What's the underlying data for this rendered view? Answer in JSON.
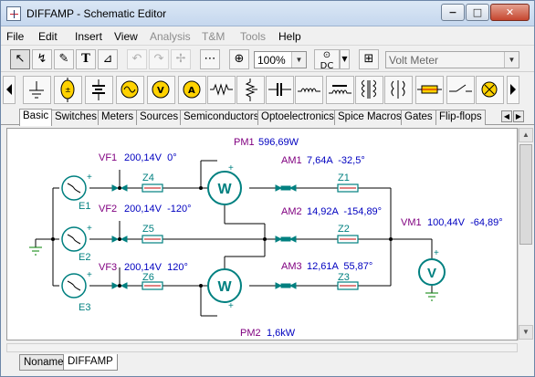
{
  "window": {
    "title": "DIFFAMP - Schematic Editor",
    "min_glyph": "−",
    "max_glyph": "□",
    "close_glyph": "✕"
  },
  "menu": [
    "File",
    "Edit",
    "Insert",
    "View",
    "Analysis",
    "T&M",
    "Tools",
    "Help"
  ],
  "menu_disabled": [
    "Analysis",
    "T&M",
    "Tools"
  ],
  "toolbar": {
    "zoom": "100%",
    "component": "Volt Meter"
  },
  "component_tabs": [
    "Basic",
    "Switches",
    "Meters",
    "Sources",
    "Semiconductors",
    "Optoelectronics",
    "Spice Macros",
    "Gates",
    "Flip-flops"
  ],
  "sheet_tabs": [
    "Noname",
    "DIFFAMP"
  ],
  "schematic": {
    "meters": [
      {
        "name": "PM1",
        "value": "596,69W"
      },
      {
        "name": "PM2",
        "value": "1,6kW"
      },
      {
        "name": "AM1",
        "value": "7,64A  -32,5°"
      },
      {
        "name": "AM2",
        "value": "14,92A  -154,89°"
      },
      {
        "name": "AM3",
        "value": "12,61A  55,87°"
      },
      {
        "name": "VM1",
        "value": "100,44V  -64,89°"
      }
    ],
    "voltmeters": [
      {
        "name": "VF1",
        "value": "200,14V  0°"
      },
      {
        "name": "VF2",
        "value": "200,14V  -120°"
      },
      {
        "name": "VF3",
        "value": "200,14V  120°"
      }
    ],
    "sources": [
      "E1",
      "E2",
      "E3"
    ],
    "impedances": [
      "Z1",
      "Z2",
      "Z3",
      "Z4",
      "Z5",
      "Z6"
    ],
    "wattmeter_glyph": "W",
    "voltmeter_glyph": "V",
    "plus": "+",
    "colors": {
      "wire": "#000000",
      "component": "#008080",
      "label_name": "#800080",
      "label_value": "#0000c0",
      "ground": "#008000"
    }
  }
}
